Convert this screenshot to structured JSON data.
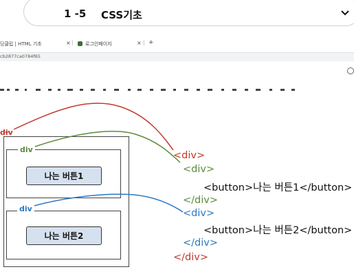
{
  "header": {
    "lesson_number": "1 -5",
    "lesson_title": "CSS기초",
    "chevron_icon": "chevron-down-icon"
  },
  "browser": {
    "tab1_label": "당클립 | HTML 기초",
    "tab1_close": "×",
    "tab2_label": "로그인페이지",
    "tab2_close": "×",
    "tab_add": "+",
    "url_fragment": "cb2877ca0784f65"
  },
  "diagram": {
    "outer_div_label": "div",
    "inner_div1_label": "div",
    "inner_div2_label": "div",
    "button1_label": "나는 버튼1",
    "button2_label": "나는 버튼2",
    "colors": {
      "outer": "#c0392b",
      "inner1": "#5b8a3a",
      "inner2": "#2a78c4",
      "button_fill": "#d6e1ef"
    }
  },
  "code": {
    "line1": "<div>",
    "line2": "<div>",
    "line3": "<button>나는 버튼1</button>",
    "line4": "</div>",
    "line5": "<div>",
    "line6": "<button>나는 버튼2</button>",
    "line7": "</div>",
    "line8": "</div>"
  }
}
